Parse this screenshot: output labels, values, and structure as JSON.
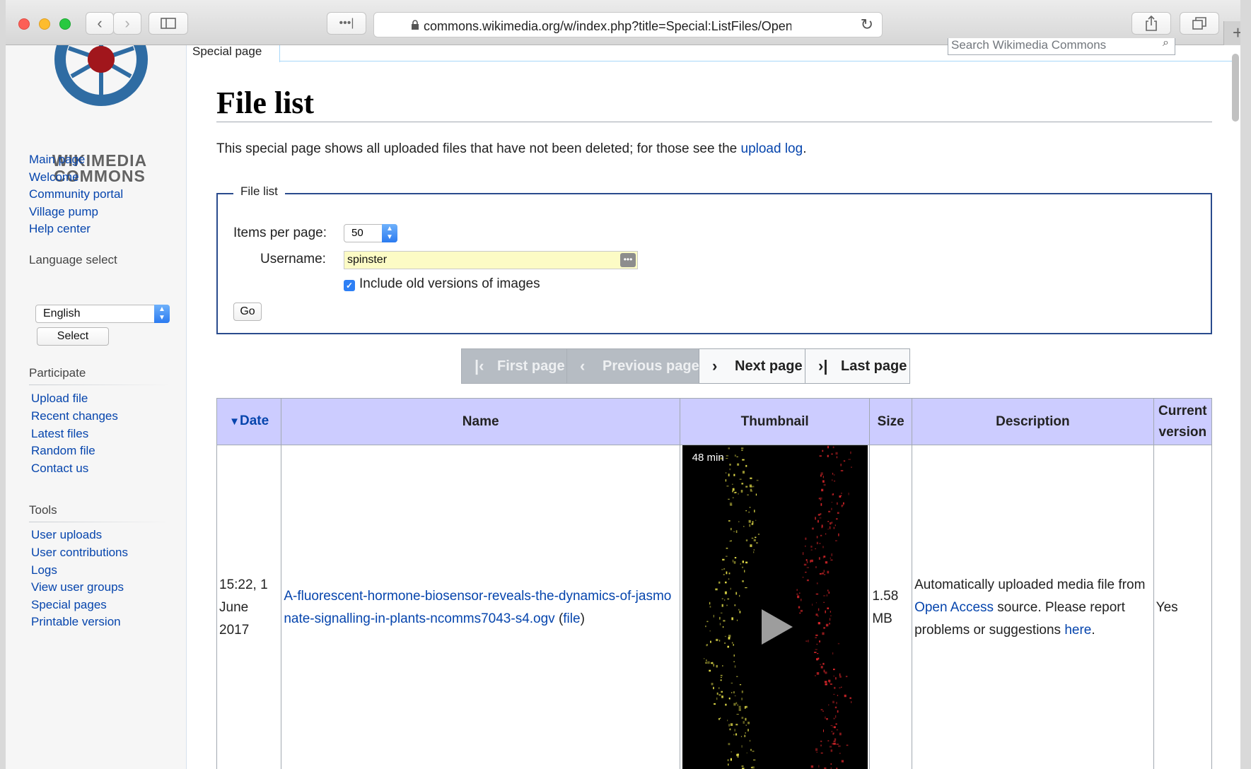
{
  "browser": {
    "url_main": "commons.wikimedia.org/w/index.php?title=Special:ListFiles/Open_Acces",
    "url_faded": "s"
  },
  "logo": {
    "line1": "WIKIMEDIA",
    "line2": "COMMONS"
  },
  "sidebar": {
    "nav": [
      "Main page",
      "Welcome",
      "Community portal",
      "Village pump",
      "Help center"
    ],
    "language_heading": "Language select",
    "language_value": "English",
    "select_label": "Select",
    "participate_heading": "Participate",
    "participate": [
      "Upload file",
      "Recent changes",
      "Latest files",
      "Random file",
      "Contact us"
    ],
    "tools_heading": "Tools",
    "tools": [
      "User uploads",
      "User contributions",
      "Logs",
      "View user groups",
      "Special pages",
      "Printable version"
    ]
  },
  "tabs": {
    "special": "Special page"
  },
  "search": {
    "placeholder": "Search Wikimedia Commons"
  },
  "page": {
    "title": "File list",
    "intro_text": "This special page shows all uploaded files that have not been deleted; for those see the ",
    "intro_link": "upload log",
    "intro_end": "."
  },
  "form": {
    "legend": "File list",
    "perpage_label": "Items per page:",
    "perpage_value": "50",
    "username_label": "Username:",
    "username_value": "spinster",
    "checkbox_label": "Include old versions of images",
    "go_label": "Go"
  },
  "pager": {
    "first": "First page",
    "prev": "Previous page",
    "next": "Next page",
    "last": "Last page"
  },
  "table": {
    "sort_arrow": "▼",
    "headers": [
      "Date",
      "Name",
      "Thumbnail",
      "Size",
      "Description",
      "Current version"
    ],
    "rows": [
      {
        "date": "15:22, 1 June 2017",
        "name": "A-fluorescent-hormone-biosensor-reveals-the-dynamics-of-jasmonate-signalling-in-plants-ncomms7043-s4.ogv",
        "name_paren_open": " (",
        "file_link": "file",
        "name_paren_close": ")",
        "thumb_duration": "48 min",
        "size": "1.58 MB",
        "desc_text1": "Automatically uploaded media file from ",
        "desc_link1": "Open Access",
        "desc_text2": " source. Please report problems or suggestions ",
        "desc_link2": "here",
        "desc_text3": ".",
        "current": "Yes"
      }
    ]
  },
  "colors": {
    "link": "#0645ad",
    "header_bg": "#ccccff",
    "fieldset_border": "#2a4b8d",
    "logo_blue": "#2f6ca3",
    "logo_red": "#a1161c"
  }
}
